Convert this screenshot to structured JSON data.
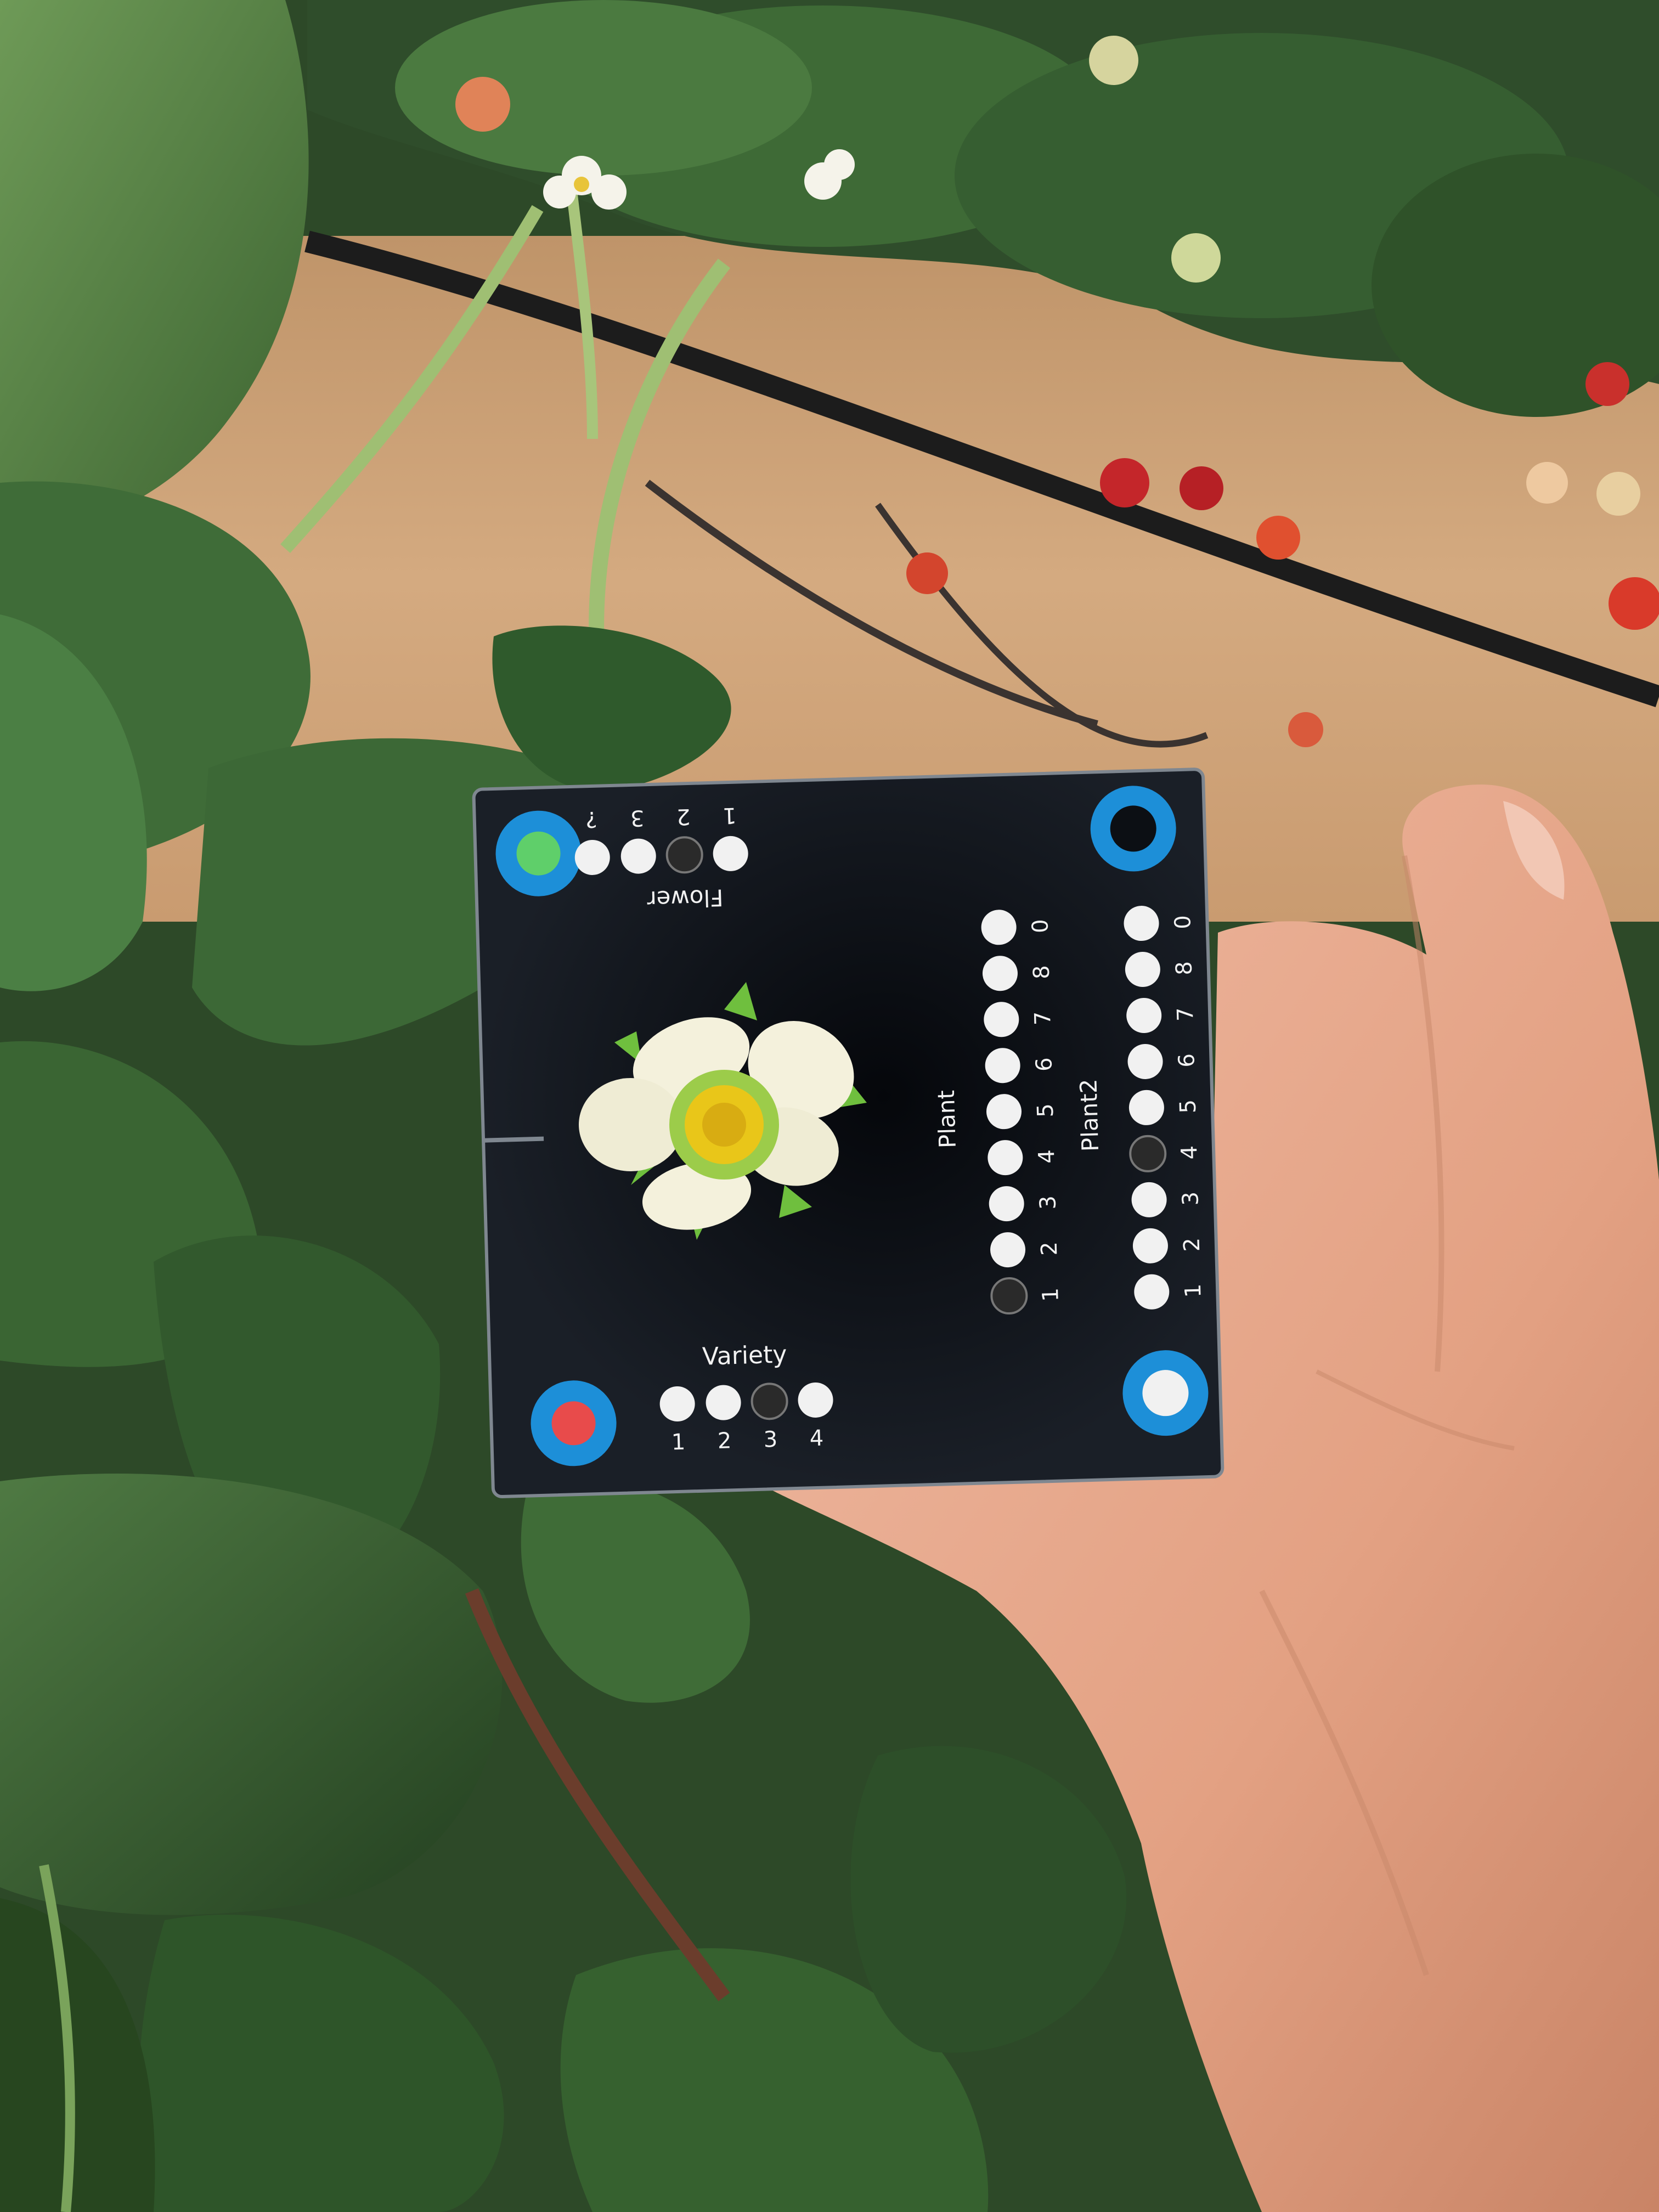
{
  "card": {
    "flower_label": "Flower",
    "flower_digits": [
      "1",
      "2",
      "3",
      "?"
    ],
    "flower_marked_index": 1,
    "variety_label": "Variety",
    "variety_digits": [
      "1",
      "2",
      "3",
      "4"
    ],
    "variety_marked_index": 2,
    "plant_label": "Plant",
    "plant_digits": [
      "1",
      "2",
      "3",
      "4",
      "5",
      "6",
      "7",
      "8",
      "0"
    ],
    "plant_marked_index": 0,
    "plant2_label": "Plant2",
    "plant2_digits": [
      "1",
      "2",
      "3",
      "4",
      "5",
      "6",
      "7",
      "8",
      "0"
    ],
    "plant2_marked_index": 3
  },
  "colors": {
    "card": "#0c0f14",
    "marker_ring": "#1d8fd8",
    "marker_green": "#5fcf6a",
    "marker_red": "#e84b4b",
    "dot": "#f1f1f1",
    "dot_marked": "#2a2a2a",
    "petal": "#f4f1dc",
    "flower_center": "#e9c619",
    "skin": "#e7a98f",
    "leaf": "#3d6b36",
    "soil": "#cfa47a"
  }
}
